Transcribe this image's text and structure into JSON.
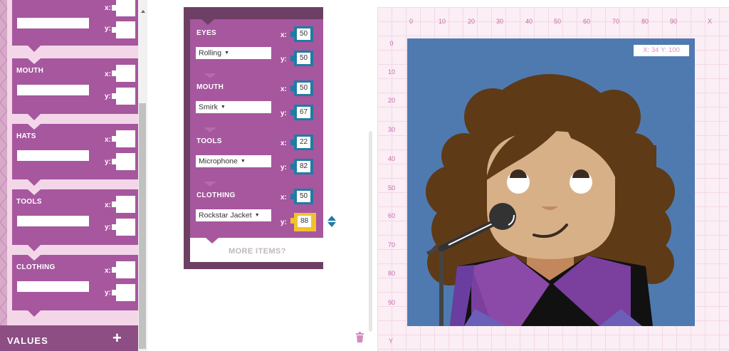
{
  "palette": {
    "blocks": [
      {
        "title": "",
        "x_label": "x:",
        "y_label": "y:"
      },
      {
        "title": "MOUTH",
        "x_label": "x:",
        "y_label": "y:"
      },
      {
        "title": "HATS",
        "x_label": "x:",
        "y_label": "y:"
      },
      {
        "title": "TOOLS",
        "x_label": "x:",
        "y_label": "y:"
      },
      {
        "title": "CLOTHING",
        "x_label": "x:",
        "y_label": "y:"
      }
    ],
    "values_label": "VALUES",
    "add_symbol": "+"
  },
  "program": {
    "sections": [
      {
        "title": "EYES",
        "choice": "Rolling",
        "x": "50",
        "y": "50",
        "x_label": "x:",
        "y_label": "y:"
      },
      {
        "title": "MOUTH",
        "choice": "Smirk",
        "x": "50",
        "y": "67",
        "x_label": "x:",
        "y_label": "y:"
      },
      {
        "title": "TOOLS",
        "choice": "Microphone",
        "x": "22",
        "y": "82",
        "x_label": "x:",
        "y_label": "y:"
      },
      {
        "title": "CLOTHING",
        "choice": "Rockstar Jacket",
        "x": "50",
        "y": "88",
        "x_label": "x:",
        "y_label": "y:"
      }
    ],
    "more_items": "MORE ITEMS?",
    "dropdown_arrow": "▼"
  },
  "stage": {
    "x_ticks": [
      "0",
      "10",
      "20",
      "30",
      "40",
      "50",
      "60",
      "70",
      "80",
      "90"
    ],
    "y_ticks": [
      "0",
      "10",
      "20",
      "30",
      "40",
      "50",
      "60",
      "70",
      "80",
      "90"
    ],
    "x_axis": "X",
    "y_axis": "Y",
    "coord_readout": "X: 34   Y: 100"
  },
  "colors": {
    "block_purple": "#a6579e",
    "program_frame": "#6e3f64",
    "slot_blue": "#1f7ca4",
    "slot_active": "#f2c12e",
    "canvas_bg": "#4f7ab0",
    "hair": "#5e3a17",
    "skin": "#d8b088",
    "jacket": "#7b3f9e"
  }
}
